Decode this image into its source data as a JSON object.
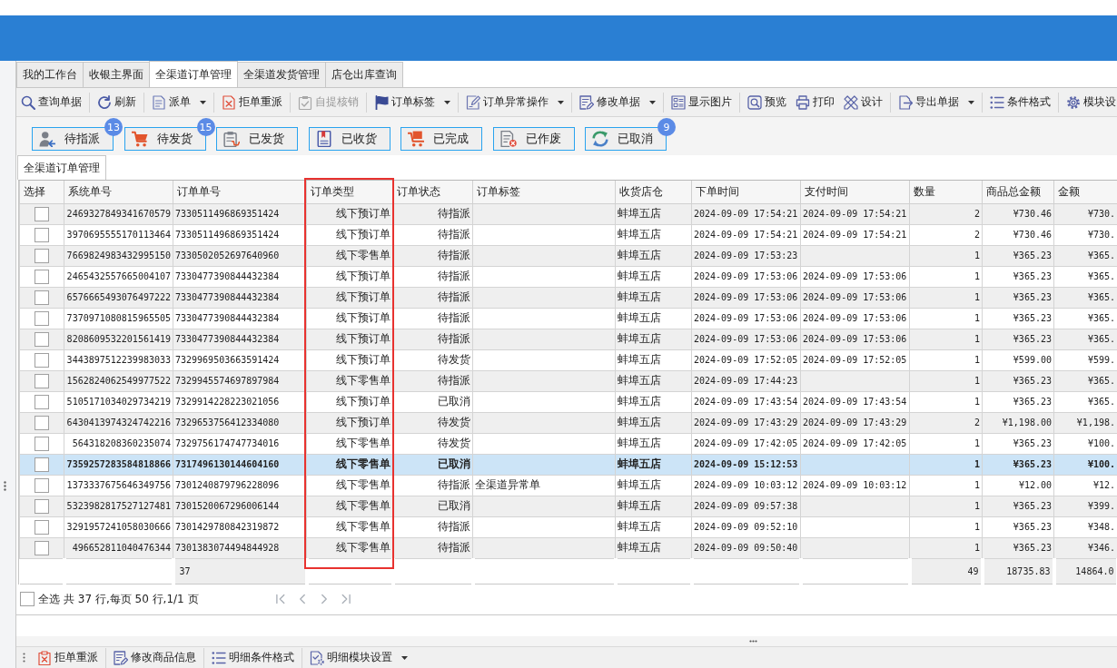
{
  "tabs": [
    {
      "label": "我的工作台",
      "selected": false
    },
    {
      "label": "收银主界面",
      "selected": false
    },
    {
      "label": "全渠道订单管理",
      "selected": true
    },
    {
      "label": "全渠道发货管理",
      "selected": false
    },
    {
      "label": "店仓出库查询",
      "selected": false
    }
  ],
  "toolbar": {
    "groups": [
      {
        "items": [
          {
            "label": "查询单据",
            "disabled": false,
            "dropdown": false
          }
        ]
      },
      {
        "items": [
          {
            "label": "刷新",
            "disabled": false,
            "dropdown": false
          }
        ]
      },
      {
        "items": [
          {
            "label": "派单",
            "disabled": false,
            "dropdown": true
          }
        ]
      },
      {
        "items": [
          {
            "label": "拒单重派",
            "disabled": false,
            "dropdown": false
          }
        ]
      },
      {
        "items": [
          {
            "label": "自提核销",
            "disabled": true,
            "dropdown": false
          }
        ]
      },
      {
        "items": [
          {
            "label": "订单标签",
            "disabled": false,
            "dropdown": true
          }
        ]
      },
      {
        "items": [
          {
            "label": "订单异常操作",
            "disabled": false,
            "dropdown": true
          }
        ]
      },
      {
        "items": [
          {
            "label": "修改单据",
            "disabled": false,
            "dropdown": true
          }
        ]
      },
      {
        "items": [
          {
            "label": "显示图片",
            "disabled": false,
            "dropdown": false
          }
        ]
      },
      {
        "items": [
          {
            "label": "预览",
            "disabled": false,
            "dropdown": false
          },
          {
            "label": "打印",
            "disabled": false,
            "dropdown": false
          },
          {
            "label": "设计",
            "disabled": false,
            "dropdown": false
          }
        ]
      },
      {
        "items": [
          {
            "label": "导出单据",
            "disabled": false,
            "dropdown": true
          }
        ]
      },
      {
        "items": [
          {
            "label": "条件格式",
            "disabled": false,
            "dropdown": false
          }
        ]
      },
      {
        "items": [
          {
            "label": "模块设",
            "disabled": false,
            "dropdown": false
          }
        ]
      }
    ]
  },
  "status_filters": [
    {
      "label": "待指派",
      "count": "13"
    },
    {
      "label": "待发货",
      "count": "15"
    },
    {
      "label": "已发货"
    },
    {
      "label": "已收货"
    },
    {
      "label": "已完成"
    },
    {
      "label": "已作废"
    },
    {
      "label": "已取消",
      "count": "9"
    }
  ],
  "panel_tabs": [
    {
      "label": "全渠道订单管理",
      "selected": true
    }
  ],
  "table": {
    "columns": [
      {
        "label": "选择",
        "highlighted": false
      },
      {
        "label": "系统单号",
        "highlighted": false
      },
      {
        "label": "订单单号",
        "highlighted": false,
        "total": "37"
      },
      {
        "label": "订单类型",
        "highlighted": true
      },
      {
        "label": "订单状态",
        "highlighted": false
      },
      {
        "label": "订单标签",
        "highlighted": false
      },
      {
        "label": "收货店仓",
        "highlighted": false
      },
      {
        "label": "下单时间",
        "highlighted": false
      },
      {
        "label": "支付时间",
        "highlighted": false
      },
      {
        "label": "数量",
        "highlighted": false,
        "total": "49"
      },
      {
        "label": "商品总金额",
        "highlighted": false,
        "total": "18735.83"
      },
      {
        "label": "金额",
        "highlighted": false,
        "total": "14864.0"
      }
    ],
    "rows": [
      {
        "selected": false,
        "checked": false,
        "system_no": "2469327849341670579",
        "order_no": "7330511496869351424",
        "order_type": "线下预订单",
        "order_status": "待指派",
        "store": "蚌埠五店",
        "order_time": "2024-09-09 17:54:21",
        "pay_time": "2024-09-09 17:54:21",
        "quantity": "2",
        "goods_total": "¥730.46",
        "amount": "¥730."
      },
      {
        "selected": false,
        "checked": false,
        "system_no": "3970695555170113464",
        "order_no": "7330511496869351424",
        "order_type": "线下预订单",
        "order_status": "待指派",
        "store": "蚌埠五店",
        "order_time": "2024-09-09 17:54:21",
        "pay_time": "2024-09-09 17:54:21",
        "quantity": "2",
        "goods_total": "¥730.46",
        "amount": "¥730."
      },
      {
        "selected": false,
        "checked": false,
        "system_no": "7669824983432995150",
        "order_no": "7330502052697640960",
        "order_type": "线下零售单",
        "order_status": "待指派",
        "store": "蚌埠五店",
        "order_time": "2024-09-09 17:53:23",
        "quantity": "1",
        "goods_total": "¥365.23",
        "amount": "¥365."
      },
      {
        "selected": false,
        "checked": false,
        "system_no": "2465432557665004107",
        "order_no": "7330477390844432384",
        "order_type": "线下预订单",
        "order_status": "待指派",
        "store": "蚌埠五店",
        "order_time": "2024-09-09 17:53:06",
        "pay_time": "2024-09-09 17:53:06",
        "quantity": "1",
        "goods_total": "¥365.23",
        "amount": "¥365."
      },
      {
        "selected": false,
        "checked": false,
        "system_no": "6576665493076497222",
        "order_no": "7330477390844432384",
        "order_type": "线下预订单",
        "order_status": "待指派",
        "store": "蚌埠五店",
        "order_time": "2024-09-09 17:53:06",
        "pay_time": "2024-09-09 17:53:06",
        "quantity": "1",
        "goods_total": "¥365.23",
        "amount": "¥365."
      },
      {
        "selected": false,
        "checked": false,
        "system_no": "7370971080815965505",
        "order_no": "7330477390844432384",
        "order_type": "线下预订单",
        "order_status": "待指派",
        "store": "蚌埠五店",
        "order_time": "2024-09-09 17:53:06",
        "pay_time": "2024-09-09 17:53:06",
        "quantity": "1",
        "goods_total": "¥365.23",
        "amount": "¥365."
      },
      {
        "selected": false,
        "checked": false,
        "system_no": "8208609532201561419",
        "order_no": "7330477390844432384",
        "order_type": "线下预订单",
        "order_status": "待指派",
        "store": "蚌埠五店",
        "order_time": "2024-09-09 17:53:06",
        "pay_time": "2024-09-09 17:53:06",
        "quantity": "1",
        "goods_total": "¥365.23",
        "amount": "¥365."
      },
      {
        "selected": false,
        "checked": false,
        "system_no": "3443897512239983033",
        "order_no": "7329969503663591424",
        "order_type": "线下预订单",
        "order_status": "待发货",
        "store": "蚌埠五店",
        "order_time": "2024-09-09 17:52:05",
        "pay_time": "2024-09-09 17:52:05",
        "quantity": "1",
        "goods_total": "¥599.00",
        "amount": "¥599."
      },
      {
        "selected": false,
        "checked": false,
        "system_no": "1562824062549977522",
        "order_no": "7329945574697897984",
        "order_type": "线下零售单",
        "order_status": "待指派",
        "store": "蚌埠五店",
        "order_time": "2024-09-09 17:44:23",
        "quantity": "1",
        "goods_total": "¥365.23",
        "amount": "¥365."
      },
      {
        "selected": false,
        "checked": false,
        "system_no": "5105171034029734219",
        "order_no": "7329914228223021056",
        "order_type": "线下预订单",
        "order_status": "已取消",
        "store": "蚌埠五店",
        "order_time": "2024-09-09 17:43:54",
        "pay_time": "2024-09-09 17:43:54",
        "quantity": "1",
        "goods_total": "¥365.23",
        "amount": "¥365."
      },
      {
        "selected": false,
        "checked": false,
        "system_no": "6430413974324742216",
        "order_no": "7329653756412334080",
        "order_type": "线下预订单",
        "order_status": "待发货",
        "store": "蚌埠五店",
        "order_time": "2024-09-09 17:43:29",
        "pay_time": "2024-09-09 17:43:29",
        "quantity": "2",
        "goods_total": "¥1,198.00",
        "amount": "¥1,198."
      },
      {
        "selected": false,
        "checked": false,
        "system_no": "564318208360235074",
        "order_no": "7329756174747734016",
        "order_type": "线下零售单",
        "order_status": "待发货",
        "store": "蚌埠五店",
        "order_time": "2024-09-09 17:42:05",
        "pay_time": "2024-09-09 17:42:05",
        "quantity": "1",
        "goods_total": "¥365.23",
        "amount": "¥100."
      },
      {
        "selected": true,
        "checked": false,
        "system_no": "7359257283584818866",
        "order_no": "7317496130144604160",
        "order_type": "线下零售单",
        "order_status": "已取消",
        "store": "蚌埠五店",
        "order_time": "2024-09-09 15:12:53",
        "quantity": "1",
        "goods_total": "¥365.23",
        "amount": "¥100."
      },
      {
        "selected": false,
        "checked": false,
        "system_no": "1373337675646349756",
        "order_no": "7301240879796228096",
        "order_type": "线下零售单",
        "order_status": "待指派",
        "order_tag": "全渠道异常单",
        "store": "蚌埠五店",
        "order_time": "2024-09-09 10:03:12",
        "pay_time": "2024-09-09 10:03:12",
        "quantity": "1",
        "goods_total": "¥12.00",
        "amount": "¥12."
      },
      {
        "selected": false,
        "checked": false,
        "system_no": "5323982817527127481",
        "order_no": "7301520067296006144",
        "order_type": "线下零售单",
        "order_status": "已取消",
        "store": "蚌埠五店",
        "order_time": "2024-09-09 09:57:38",
        "quantity": "1",
        "goods_total": "¥365.23",
        "amount": "¥399."
      },
      {
        "selected": false,
        "checked": false,
        "system_no": "3291957241058030666",
        "order_no": "7301429780842319872",
        "order_type": "线下零售单",
        "order_status": "待指派",
        "store": "蚌埠五店",
        "order_time": "2024-09-09 09:52:10",
        "quantity": "1",
        "goods_total": "¥365.23",
        "amount": "¥348."
      },
      {
        "selected": false,
        "checked": false,
        "system_no": "496652811040476344",
        "order_no": "7301383074494844928",
        "order_type": "线下零售单",
        "order_status": "待指派",
        "store": "蚌埠五店",
        "order_time": "2024-09-09 09:50:40",
        "quantity": "1",
        "goods_total": "¥365.23",
        "amount": "¥346."
      }
    ]
  },
  "pager": {
    "select_all": {
      "label": "全选",
      "checked": false
    },
    "summary": "共 37 行,每页 50 行,1/1 页",
    "nav": [
      {
        "disabled": true
      },
      {
        "disabled": true
      },
      {
        "disabled": true
      },
      {
        "disabled": true
      }
    ]
  },
  "detail_toolbar": [
    {
      "label": "拒单重派",
      "dropdown": false
    },
    {
      "label": "修改商品信息",
      "dropdown": false
    },
    {
      "label": "明细条件格式",
      "dropdown": false
    },
    {
      "label": "明细模块设置",
      "dropdown": true
    }
  ]
}
